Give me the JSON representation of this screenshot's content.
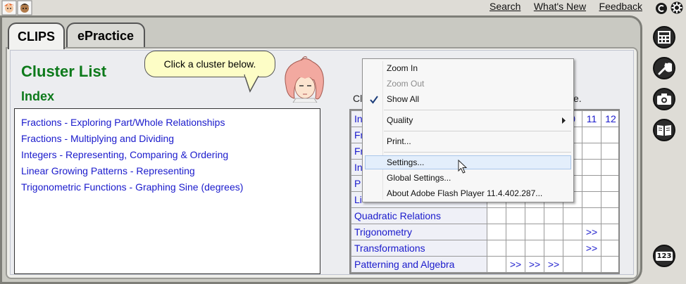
{
  "header": {
    "links": [
      "Search",
      "What's New",
      "Feedback"
    ]
  },
  "tabs": [
    {
      "label": "CLIPS",
      "active": true
    },
    {
      "label": "ePractice",
      "active": false
    }
  ],
  "main": {
    "title": "Cluster List",
    "index_heading": "Index",
    "bubble_text": "Click a cluster below.",
    "partial_left": "Cl",
    "partial_right": "e.",
    "index_links": [
      "Fractions - Exploring Part/Whole Relationships",
      "Fractions - Multiplying and Dividing",
      "Integers - Representing, Comparing & Ordering",
      "Linear Growing Patterns - Representing",
      "Trigonometric Functions - Graphing Sine (degrees)"
    ]
  },
  "grid": {
    "columns_visible": [
      "0",
      "11",
      "12"
    ],
    "topic_partials": [
      "In",
      "Fr",
      "Fr",
      "In",
      "P",
      "Li"
    ],
    "rows": [
      {
        "topic": "Quadratic Relations",
        "cells": [
          "",
          "",
          "",
          "",
          "",
          "",
          ""
        ]
      },
      {
        "topic": "Trigonometry",
        "cells": [
          "",
          "",
          "",
          "",
          "",
          ">>",
          ""
        ]
      },
      {
        "topic": "Transformations",
        "cells": [
          "",
          "",
          "",
          "",
          "",
          ">>",
          ""
        ]
      },
      {
        "topic": "Patterning and Algebra",
        "cells": [
          "",
          ">>",
          ">>",
          ">>",
          "",
          "",
          ""
        ]
      }
    ]
  },
  "context_menu": {
    "items": [
      {
        "label": "Zoom In",
        "disabled": false,
        "checked": false
      },
      {
        "label": "Zoom Out",
        "disabled": true,
        "checked": false
      },
      {
        "label": "Show All",
        "disabled": false,
        "checked": true
      },
      {
        "label": "Quality",
        "disabled": false,
        "submenu": true
      },
      {
        "label": "Print...",
        "disabled": false
      },
      {
        "label": "Settings...",
        "disabled": false,
        "hover": true
      },
      {
        "label": "Global Settings...",
        "disabled": false
      },
      {
        "label": "About Adobe Flash Player 11.4.402.287...",
        "disabled": false
      }
    ]
  },
  "sidebar": {
    "buttons": [
      "calculator-icon",
      "wrench-icon",
      "camera-icon",
      "book-icon",
      "number-pad-icon"
    ],
    "number_label": "123"
  },
  "colors": {
    "heading_green": "#0d7a1b",
    "link_blue": "#1a1acc",
    "bubble_yellow": "#fdfdc6"
  }
}
